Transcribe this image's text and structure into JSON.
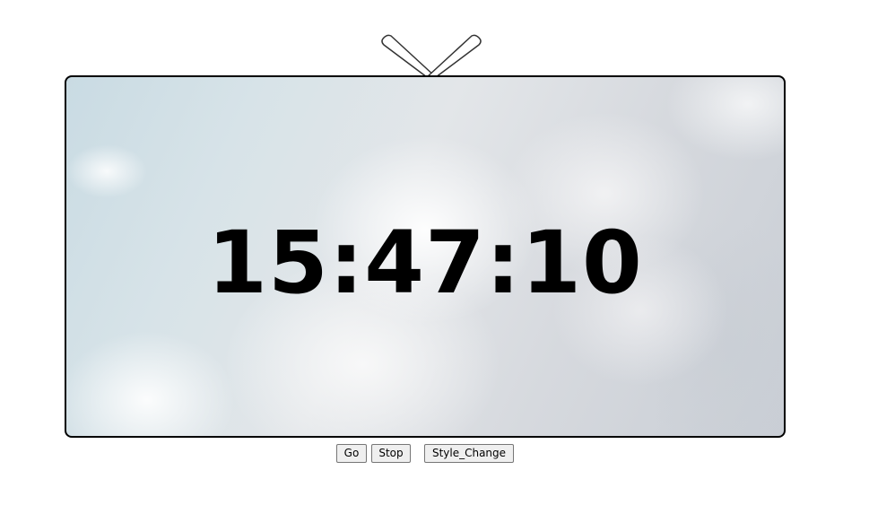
{
  "clock": {
    "time": "15:47:10"
  },
  "controls": {
    "go_label": "Go",
    "stop_label": "Stop",
    "style_change_label": "Style_Change"
  },
  "colors": {
    "frame_border": "#000000",
    "time_text": "#000000",
    "sky_light": "#c9dbe3",
    "cloud": "#ffffff",
    "button_bg": "#efefef",
    "button_border": "#767676"
  },
  "icons": {
    "antenna": "tv-antenna-icon"
  }
}
